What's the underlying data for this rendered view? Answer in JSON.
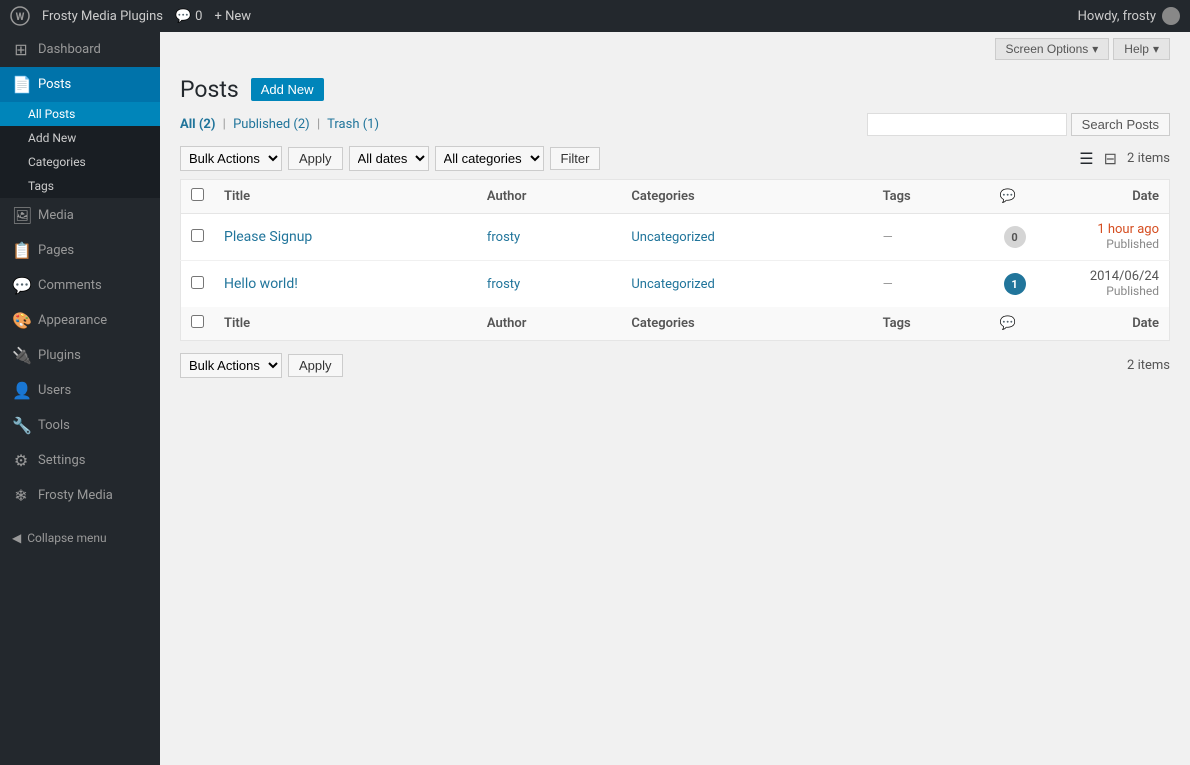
{
  "adminbar": {
    "wp_logo": "W",
    "site_name": "Frosty Media Plugins",
    "comments_icon": "💬",
    "comments_count": "0",
    "new_label": "+ New",
    "howdy": "Howdy, frosty"
  },
  "sidebar": {
    "items": [
      {
        "id": "dashboard",
        "label": "Dashboard",
        "icon": "⊞"
      },
      {
        "id": "posts",
        "label": "Posts",
        "icon": "📄",
        "active": true
      },
      {
        "id": "all-posts",
        "label": "All Posts",
        "sub": true,
        "active": true
      },
      {
        "id": "add-new",
        "label": "Add New",
        "sub": true
      },
      {
        "id": "categories",
        "label": "Categories",
        "sub": true
      },
      {
        "id": "tags",
        "label": "Tags",
        "sub": true
      },
      {
        "id": "media",
        "label": "Media",
        "icon": "🖼"
      },
      {
        "id": "pages",
        "label": "Pages",
        "icon": "📋"
      },
      {
        "id": "comments",
        "label": "Comments",
        "icon": "💬"
      },
      {
        "id": "appearance",
        "label": "Appearance",
        "icon": "🎨"
      },
      {
        "id": "plugins",
        "label": "Plugins",
        "icon": "🔌"
      },
      {
        "id": "users",
        "label": "Users",
        "icon": "👤"
      },
      {
        "id": "tools",
        "label": "Tools",
        "icon": "🔧"
      },
      {
        "id": "settings",
        "label": "Settings",
        "icon": "⚙"
      },
      {
        "id": "frosty-media",
        "label": "Frosty Media",
        "icon": "❄"
      }
    ],
    "collapse_label": "Collapse menu"
  },
  "screen_options": {
    "label": "Screen Options",
    "arrow": "▾"
  },
  "help": {
    "label": "Help",
    "arrow": "▾"
  },
  "page": {
    "title": "Posts",
    "add_new_btn": "Add New"
  },
  "filter_links": {
    "all_label": "All",
    "all_count": "(2)",
    "published_label": "Published",
    "published_count": "(2)",
    "trash_label": "Trash",
    "trash_count": "(1)"
  },
  "search": {
    "placeholder": "",
    "button_label": "Search Posts"
  },
  "tablenav_top": {
    "bulk_actions_label": "Bulk Actions",
    "apply_label": "Apply",
    "all_dates_label": "All dates",
    "all_categories_label": "All categories",
    "filter_label": "Filter",
    "items_count": "2 items",
    "view_list_label": "List view",
    "view_excerpt_label": "Excerpt view"
  },
  "table": {
    "columns": {
      "title": "Title",
      "author": "Author",
      "categories": "Categories",
      "tags": "Tags",
      "date": "Date"
    },
    "rows": [
      {
        "id": "1",
        "title": "Please Signup",
        "author": "frosty",
        "categories": "Uncategorized",
        "tags": "—",
        "comments": "0",
        "has_comments": false,
        "date_line1": "1 hour ago",
        "date_line2": "Published",
        "date_urgent": true
      },
      {
        "id": "2",
        "title": "Hello world!",
        "author": "frosty",
        "categories": "Uncategorized",
        "tags": "—",
        "comments": "1",
        "has_comments": true,
        "date_line1": "2014/06/24",
        "date_line2": "Published",
        "date_urgent": false
      }
    ]
  },
  "tablenav_bottom": {
    "bulk_actions_label": "Bulk Actions",
    "apply_label": "Apply",
    "items_count": "2 items"
  }
}
